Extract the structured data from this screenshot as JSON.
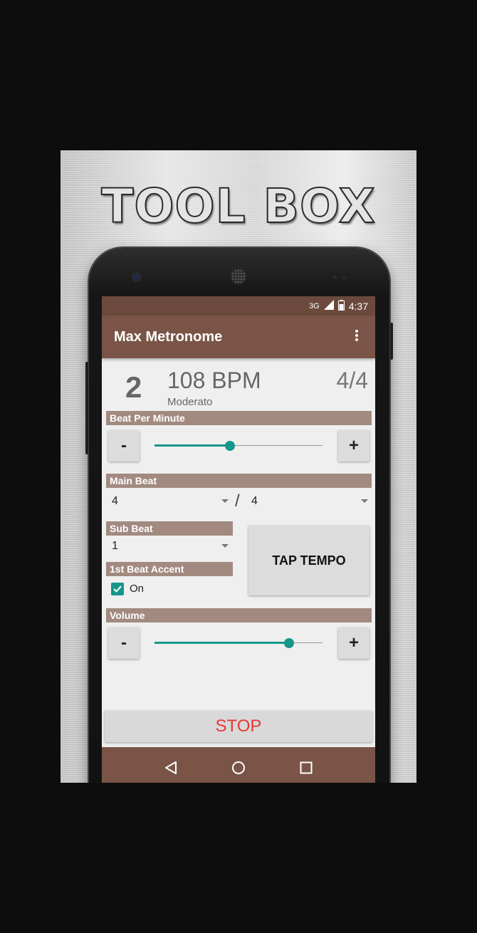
{
  "promo": {
    "title": "TOOL BOX"
  },
  "status_bar": {
    "network": "3G",
    "time": "4:37"
  },
  "app_bar": {
    "title": "Max Metronome",
    "overflow_icon": "more-vert-icon"
  },
  "header": {
    "beat_number": "2",
    "bpm": "108 BPM",
    "tempo_name": "Moderato",
    "time_signature": "4/4"
  },
  "bpm_section": {
    "label": "Beat Per Minute",
    "minus_label": "-",
    "plus_label": "+",
    "slider_fraction": 0.45
  },
  "main_beat": {
    "label": "Main Beat",
    "numerator": "4",
    "separator": "/",
    "denominator": "4"
  },
  "sub_beat": {
    "label": "Sub Beat",
    "value": "1"
  },
  "accent": {
    "label": "1st Beat Accent",
    "checkbox_label": "On",
    "checked": true
  },
  "tap_tempo": {
    "label": "TAP TEMPO"
  },
  "volume": {
    "label": "Volume",
    "minus_label": "-",
    "plus_label": "+",
    "slider_fraction": 0.8
  },
  "stop": {
    "label": "STOP"
  },
  "nav": {
    "back_icon": "back-triangle-icon",
    "home_icon": "home-circle-icon",
    "recents_icon": "recents-square-icon"
  },
  "colors": {
    "primary_dark": "#6b4a3d",
    "primary": "#7a5547",
    "accent": "#16968a",
    "label_bar": "#a28a80",
    "stop_text": "#e53935"
  }
}
